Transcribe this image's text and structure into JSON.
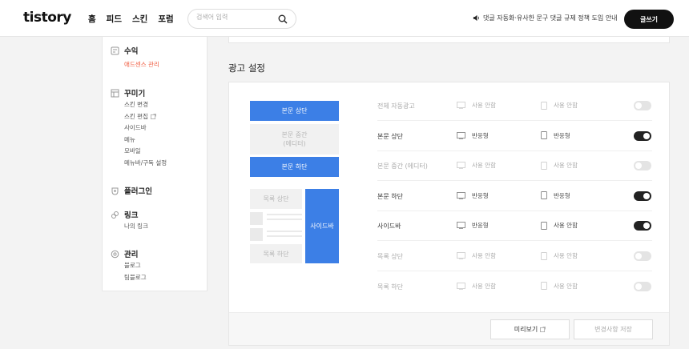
{
  "header": {
    "logo": "tistory",
    "nav": [
      "홈",
      "피드",
      "스킨",
      "포럼"
    ],
    "search_placeholder": "검색어 입력",
    "notice": "댓글 자동화·유사한 문구 댓글 규제 정책 도입 안내",
    "write_label": "글쓰기"
  },
  "sidebar": {
    "revenue": {
      "title": "수익",
      "items": [
        "애드센스 관리"
      ]
    },
    "decorate": {
      "title": "꾸미기",
      "items": [
        "스킨 변경",
        "스킨 편집",
        "사이드바",
        "메뉴",
        "모바일",
        "메뉴바/구독 설정"
      ]
    },
    "plugin": {
      "title": "플러그인"
    },
    "link": {
      "title": "링크",
      "items": [
        "나의 링크"
      ]
    },
    "manage": {
      "title": "관리",
      "items": [
        "블로그",
        "팀블로그"
      ]
    }
  },
  "section_title": "광고 설정",
  "preview": {
    "body_top": "본문 상단",
    "body_mid_1": "본문 중간",
    "body_mid_2": "(에디터)",
    "body_bottom": "본문 하단",
    "list_top": "목록 상단",
    "list_bottom": "목록 하단",
    "sidebar": "사이드바"
  },
  "rows": [
    {
      "label": "전체 자동광고",
      "web": "사용 안함",
      "mobile": "사용 안함",
      "on": false,
      "disabled": true
    },
    {
      "label": "본문 상단",
      "web": "반응형",
      "mobile": "반응형",
      "on": true,
      "disabled": false
    },
    {
      "label": "본문 중간 (에디터)",
      "web": "사용 안함",
      "mobile": "사용 안함",
      "on": false,
      "disabled": true
    },
    {
      "label": "본문 하단",
      "web": "반응형",
      "mobile": "반응형",
      "on": true,
      "disabled": false
    },
    {
      "label": "사이드바",
      "web": "반응형",
      "mobile": "사용 안함",
      "on": true,
      "disabled": false
    },
    {
      "label": "목록 상단",
      "web": "사용 안함",
      "mobile": "사용 안함",
      "on": false,
      "disabled": true
    },
    {
      "label": "목록 하단",
      "web": "사용 안함",
      "mobile": "사용 안함",
      "on": false,
      "disabled": true
    }
  ],
  "footer": {
    "preview_label": "미리보기",
    "save_label": "변경사항 저장"
  },
  "colors": {
    "accent_blue": "#3c7fe6",
    "active_red": "#f05b3f",
    "toggle_on": "#222222"
  }
}
